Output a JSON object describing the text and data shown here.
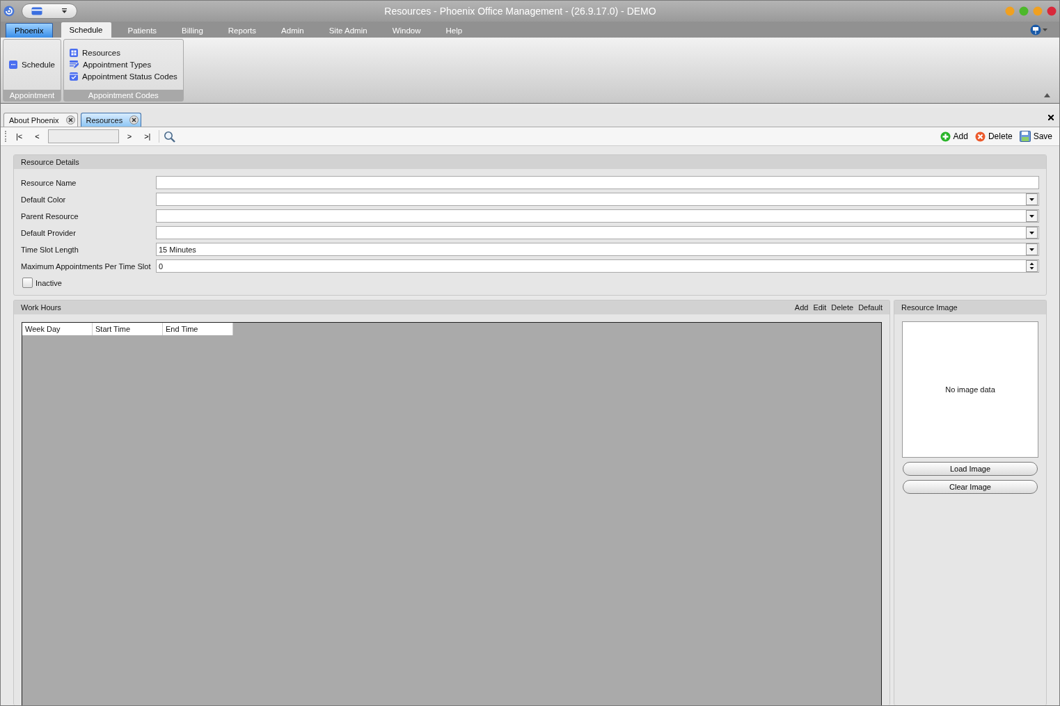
{
  "window": {
    "title": "Resources - Phoenix Office Management - (26.9.17.0) - DEMO"
  },
  "menu_tabs": [
    {
      "label": "Phoenix",
      "kind": "app",
      "selected": false
    },
    {
      "label": "Schedule",
      "kind": "tab",
      "selected": true
    },
    {
      "label": "Patients",
      "kind": "tab",
      "selected": false
    },
    {
      "label": "Billing",
      "kind": "tab",
      "selected": false
    },
    {
      "label": "Reports",
      "kind": "tab",
      "selected": false
    },
    {
      "label": "Admin",
      "kind": "tab",
      "selected": false
    },
    {
      "label": "Site Admin",
      "kind": "tab",
      "selected": false
    },
    {
      "label": "Window",
      "kind": "tab",
      "selected": false
    },
    {
      "label": "Help",
      "kind": "tab",
      "selected": false
    }
  ],
  "ribbon": {
    "groups": [
      {
        "title": "Appointment",
        "items": [
          {
            "label": "Schedule",
            "kind": "schedule"
          }
        ]
      },
      {
        "title": "Appointment Codes",
        "items": [
          {
            "label": "Resources",
            "kind": "grid"
          },
          {
            "label": "Appointment Types",
            "kind": "types"
          },
          {
            "label": "Appointment Status Codes",
            "kind": "status"
          }
        ]
      }
    ]
  },
  "document_tabs": [
    {
      "label": "About Phoenix",
      "selected": false
    },
    {
      "label": "Resources",
      "selected": true
    }
  ],
  "navigator": {
    "buttons": [
      "|<",
      "<",
      ">",
      ">|"
    ]
  },
  "actions": [
    {
      "label": "Add",
      "kind": "add"
    },
    {
      "label": "Delete",
      "kind": "delete"
    },
    {
      "label": "Save",
      "kind": "save"
    }
  ],
  "resource_details": {
    "title": "Resource Details",
    "fields": [
      {
        "label": "Resource Name",
        "kind": "text"
      },
      {
        "label": "Default Color",
        "kind": "dropdown"
      },
      {
        "label": "Parent Resource",
        "kind": "dropdown"
      },
      {
        "label": "Default Provider",
        "kind": "dropdown"
      },
      {
        "label": "Time Slot Length",
        "kind": "dropdown",
        "value": "15 Minutes"
      },
      {
        "label": "Maximum Appointments Per Time Slot",
        "kind": "spinner",
        "value": "0"
      }
    ],
    "inactive": {
      "label": "Inactive",
      "checked": false
    }
  },
  "work_hours": {
    "title": "Work Hours",
    "actions": [
      "Add",
      "Edit",
      "Delete",
      "Default"
    ],
    "columns": [
      "Week Day",
      "Start Time",
      "End Time"
    ]
  },
  "resource_image": {
    "title": "Resource Image",
    "empty_text": "No image data",
    "buttons": [
      "Load Image",
      "Clear Image"
    ]
  }
}
